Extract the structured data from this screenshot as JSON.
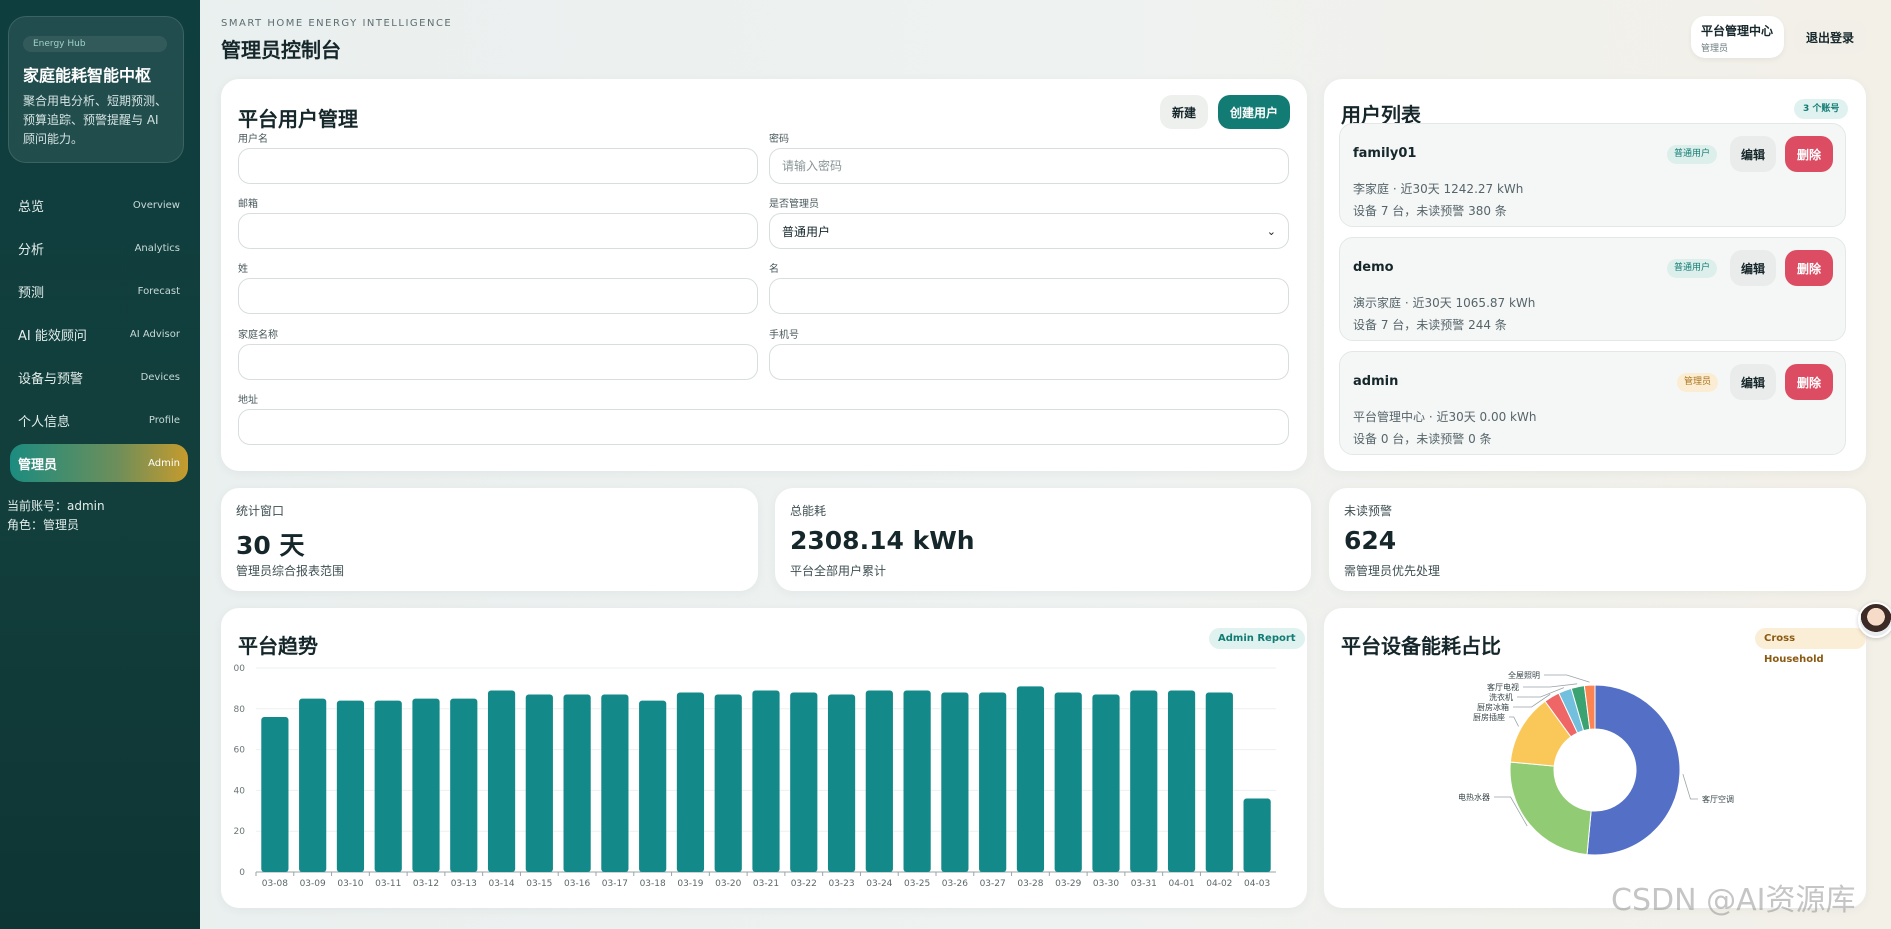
{
  "sidebar": {
    "brand_tag": "Energy Hub",
    "brand_title": "家庭能耗智能中枢",
    "brand_desc": "聚合用电分析、短期预测、预算追踪、预警提醒与 AI 顾问能力。",
    "items": [
      {
        "label": "总览",
        "en": "Overview"
      },
      {
        "label": "分析",
        "en": "Analytics"
      },
      {
        "label": "预测",
        "en": "Forecast"
      },
      {
        "label": "AI 能效顾问",
        "en": "AI Advisor"
      },
      {
        "label": "设备与预警",
        "en": "Devices"
      },
      {
        "label": "个人信息",
        "en": "Profile"
      },
      {
        "label": "管理员",
        "en": "Admin"
      }
    ],
    "active_index": 6,
    "account_line": "当前账号：admin",
    "role_line": "角色：管理员"
  },
  "header": {
    "eyebrow": "SMART HOME ENERGY INTELLIGENCE",
    "title": "管理员控制台",
    "center_title": "平台管理中心",
    "center_sub": "管理员",
    "logout_label": "退出登录"
  },
  "user_form": {
    "title": "平台用户管理",
    "new_label": "新建",
    "create_label": "创建用户",
    "fields": {
      "username": {
        "label": "用户名",
        "value": "",
        "placeholder": ""
      },
      "password": {
        "label": "密码",
        "value": "",
        "placeholder": "请输入密码"
      },
      "email": {
        "label": "邮箱",
        "value": "",
        "placeholder": ""
      },
      "is_admin": {
        "label": "是否管理员",
        "value": "普通用户"
      },
      "last_name": {
        "label": "姓",
        "value": "",
        "placeholder": ""
      },
      "first_name": {
        "label": "名",
        "value": "",
        "placeholder": ""
      },
      "family": {
        "label": "家庭名称",
        "value": "",
        "placeholder": ""
      },
      "phone": {
        "label": "手机号",
        "value": "",
        "placeholder": ""
      },
      "address": {
        "label": "地址",
        "value": "",
        "placeholder": ""
      }
    }
  },
  "user_list": {
    "title": "用户列表",
    "count_badge": "3 个账号",
    "edit_label": "编辑",
    "delete_label": "删除",
    "users": [
      {
        "name": "family01",
        "role": "普通用户",
        "line1": "李家庭 · 近30天 1242.27 kWh",
        "line2": "设备 7 台，未读预警 380 条"
      },
      {
        "name": "demo",
        "role": "普通用户",
        "line1": "演示家庭 · 近30天 1065.87 kWh",
        "line2": "设备 7 台，未读预警 244 条"
      },
      {
        "name": "admin",
        "role": "管理员",
        "line1": "平台管理中心 · 近30天 0.00 kWh",
        "line2": "设备 0 台，未读预警 0 条"
      }
    ]
  },
  "stats": [
    {
      "label": "统计窗口",
      "value": "30 天",
      "note": "管理员综合报表范围"
    },
    {
      "label": "总能耗",
      "value": "2308.14 kWh",
      "note": "平台全部用户累计"
    },
    {
      "label": "未读预警",
      "value": "624",
      "note": "需管理员优先处理"
    }
  ],
  "trend_card": {
    "title": "平台趋势",
    "chip": "Admin Report"
  },
  "share_card": {
    "title": "平台设备能耗占比",
    "chip": "Cross Household"
  },
  "colors": {
    "accent": "#127b74",
    "bar": "#13898a",
    "danger": "#dc4d63",
    "pie": [
      "#5470c6",
      "#91cc75",
      "#fac858",
      "#ee6666",
      "#73c0de",
      "#3ba272",
      "#fc8452"
    ]
  },
  "chart_data": [
    {
      "type": "bar",
      "title": "",
      "categories": [
        "03-08",
        "03-09",
        "03-10",
        "03-11",
        "03-12",
        "03-13",
        "03-14",
        "03-15",
        "03-16",
        "03-17",
        "03-18",
        "03-19",
        "03-20",
        "03-21",
        "03-22",
        "03-23",
        "03-24",
        "03-25",
        "03-26",
        "03-27",
        "03-28",
        "03-29",
        "03-30",
        "03-31",
        "04-01",
        "04-02",
        "04-03"
      ],
      "values": [
        76,
        85,
        84,
        84,
        85,
        85,
        89,
        87,
        87,
        87,
        84,
        88,
        87,
        89,
        88,
        87,
        89,
        89,
        88,
        88,
        91,
        88,
        87,
        89,
        89,
        88,
        36
      ],
      "yticks": [
        "0",
        "20",
        "40",
        "60",
        "80",
        "00"
      ],
      "ylim": [
        0,
        100
      ],
      "grid": true
    },
    {
      "type": "pie",
      "title": "",
      "labels": [
        "客厅空调",
        "电热水器",
        "厨房插座",
        "厨房冰箱",
        "洗衣机",
        "客厅电视",
        "全屋照明"
      ],
      "values": [
        51.5,
        25,
        13.5,
        3,
        2.5,
        2.5,
        2
      ]
    }
  ],
  "watermark": "CSDN @AI资源库"
}
